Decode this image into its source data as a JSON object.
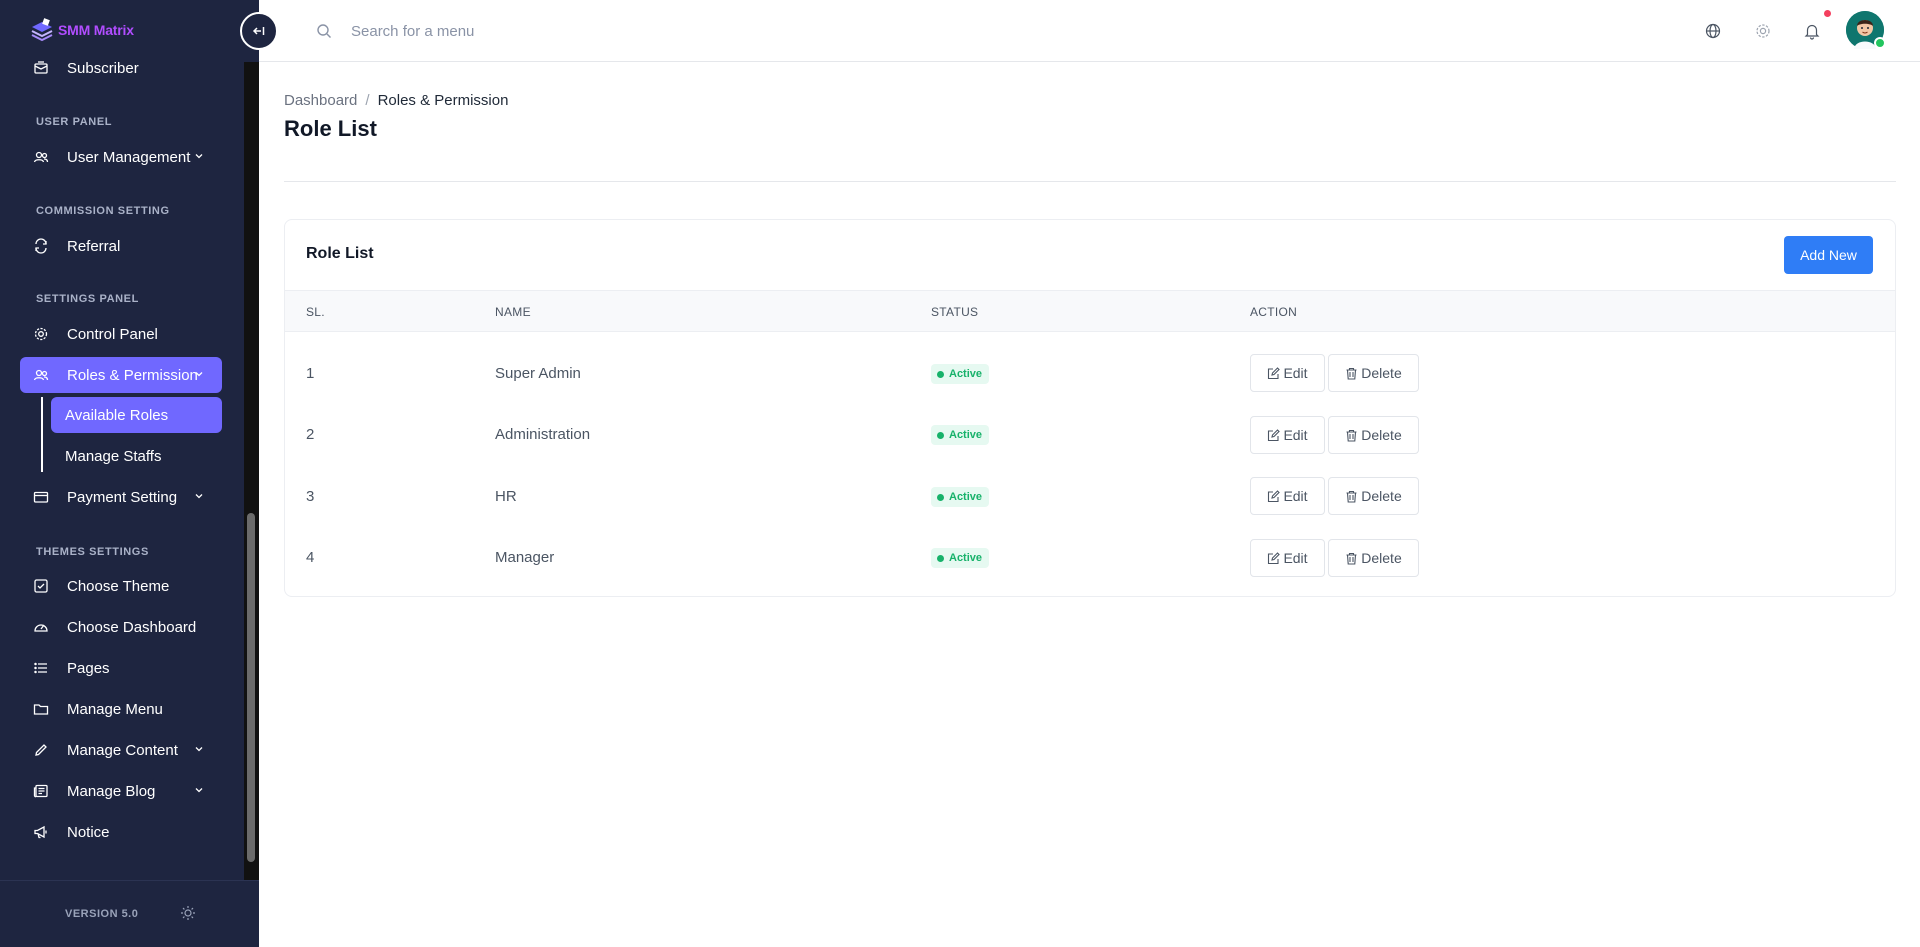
{
  "app": {
    "name": "SMM Matrix",
    "version_label": "VERSION 5.0"
  },
  "sidebar": {
    "sections": [
      {
        "title": "USER PANEL"
      },
      {
        "title": "COMMISSION SETTING"
      },
      {
        "title": "SETTINGS PANEL"
      },
      {
        "title": "THEMES SETTINGS"
      }
    ],
    "items": {
      "subscriber": "Subscriber",
      "user_management": "User Management",
      "referral": "Referral",
      "control_panel": "Control Panel",
      "roles_permission": "Roles & Permission",
      "available_roles": "Available Roles",
      "manage_staffs": "Manage Staffs",
      "payment_setting": "Payment Setting",
      "choose_theme": "Choose Theme",
      "choose_dashboard": "Choose Dashboard",
      "pages": "Pages",
      "manage_menu": "Manage Menu",
      "manage_content": "Manage Content",
      "manage_blog": "Manage Blog",
      "notice": "Notice"
    }
  },
  "header": {
    "search_placeholder": "Search for a menu"
  },
  "breadcrumb": {
    "home": "Dashboard",
    "separator": "/",
    "current": "Roles & Permission"
  },
  "page": {
    "title": "Role List"
  },
  "card": {
    "title": "Role List",
    "add_button": "Add New",
    "columns": {
      "sl": "SL.",
      "name": "NAME",
      "status": "STATUS",
      "action": "ACTION"
    },
    "rows": [
      {
        "sl": "1",
        "name": "Super Admin",
        "status": "Active"
      },
      {
        "sl": "2",
        "name": "Administration",
        "status": "Active"
      },
      {
        "sl": "3",
        "name": "HR",
        "status": "Active"
      },
      {
        "sl": "4",
        "name": "Manager",
        "status": "Active"
      }
    ],
    "edit_label": "Edit",
    "delete_label": "Delete"
  },
  "colors": {
    "sidebar_bg": "#1e2540",
    "accent": "#7068ff",
    "primary_button": "#2f7df6",
    "active_badge": "#17b26a",
    "logo_text": "#b14dff"
  }
}
